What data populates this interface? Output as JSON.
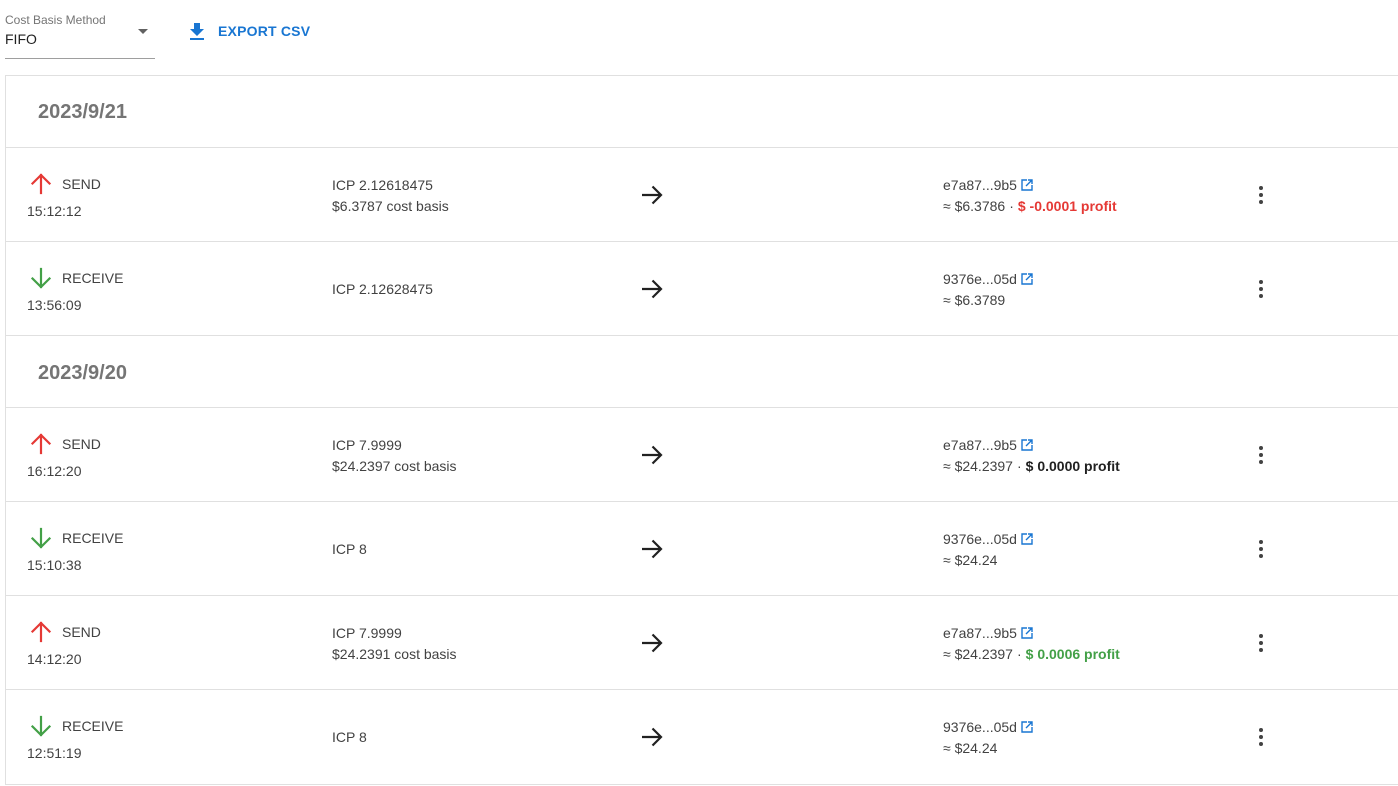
{
  "toolbar": {
    "cost_basis": {
      "label": "Cost Basis Method",
      "value": "FIFO"
    },
    "export": {
      "label": "EXPORT CSV",
      "icon": "download-icon"
    }
  },
  "colors": {
    "accent": "#1976d2",
    "send": "#e53935",
    "receive": "#43a047",
    "loss": "#e53935",
    "gain": "#43a047"
  },
  "groups": [
    {
      "date": "2023/9/21",
      "transactions": [
        {
          "type": "SEND",
          "time": "15:12:12",
          "amount": "ICP 2.12618475",
          "cost_basis": "$6.3787 cost basis",
          "counterparty": "e7a87...9b5",
          "value": "≈ $6.3786",
          "profit": "$ -0.0001 profit",
          "profit_sign": "neg"
        },
        {
          "type": "RECEIVE",
          "time": "13:56:09",
          "amount": "ICP 2.12628475",
          "cost_basis": "",
          "counterparty": "9376e...05d",
          "value": "≈ $6.3789",
          "profit": "",
          "profit_sign": ""
        }
      ]
    },
    {
      "date": "2023/9/20",
      "transactions": [
        {
          "type": "SEND",
          "time": "16:12:20",
          "amount": "ICP 7.9999",
          "cost_basis": "$24.2397 cost basis",
          "counterparty": "e7a87...9b5",
          "value": "≈ $24.2397",
          "profit": "$ 0.0000 profit",
          "profit_sign": "zero"
        },
        {
          "type": "RECEIVE",
          "time": "15:10:38",
          "amount": "ICP 8",
          "cost_basis": "",
          "counterparty": "9376e...05d",
          "value": "≈ $24.24",
          "profit": "",
          "profit_sign": ""
        },
        {
          "type": "SEND",
          "time": "14:12:20",
          "amount": "ICP 7.9999",
          "cost_basis": "$24.2391 cost basis",
          "counterparty": "e7a87...9b5",
          "value": "≈ $24.2397",
          "profit": "$ 0.0006 profit",
          "profit_sign": "pos"
        },
        {
          "type": "RECEIVE",
          "time": "12:51:19",
          "amount": "ICP 8",
          "cost_basis": "",
          "counterparty": "9376e...05d",
          "value": "≈ $24.24",
          "profit": "",
          "profit_sign": ""
        }
      ]
    }
  ]
}
